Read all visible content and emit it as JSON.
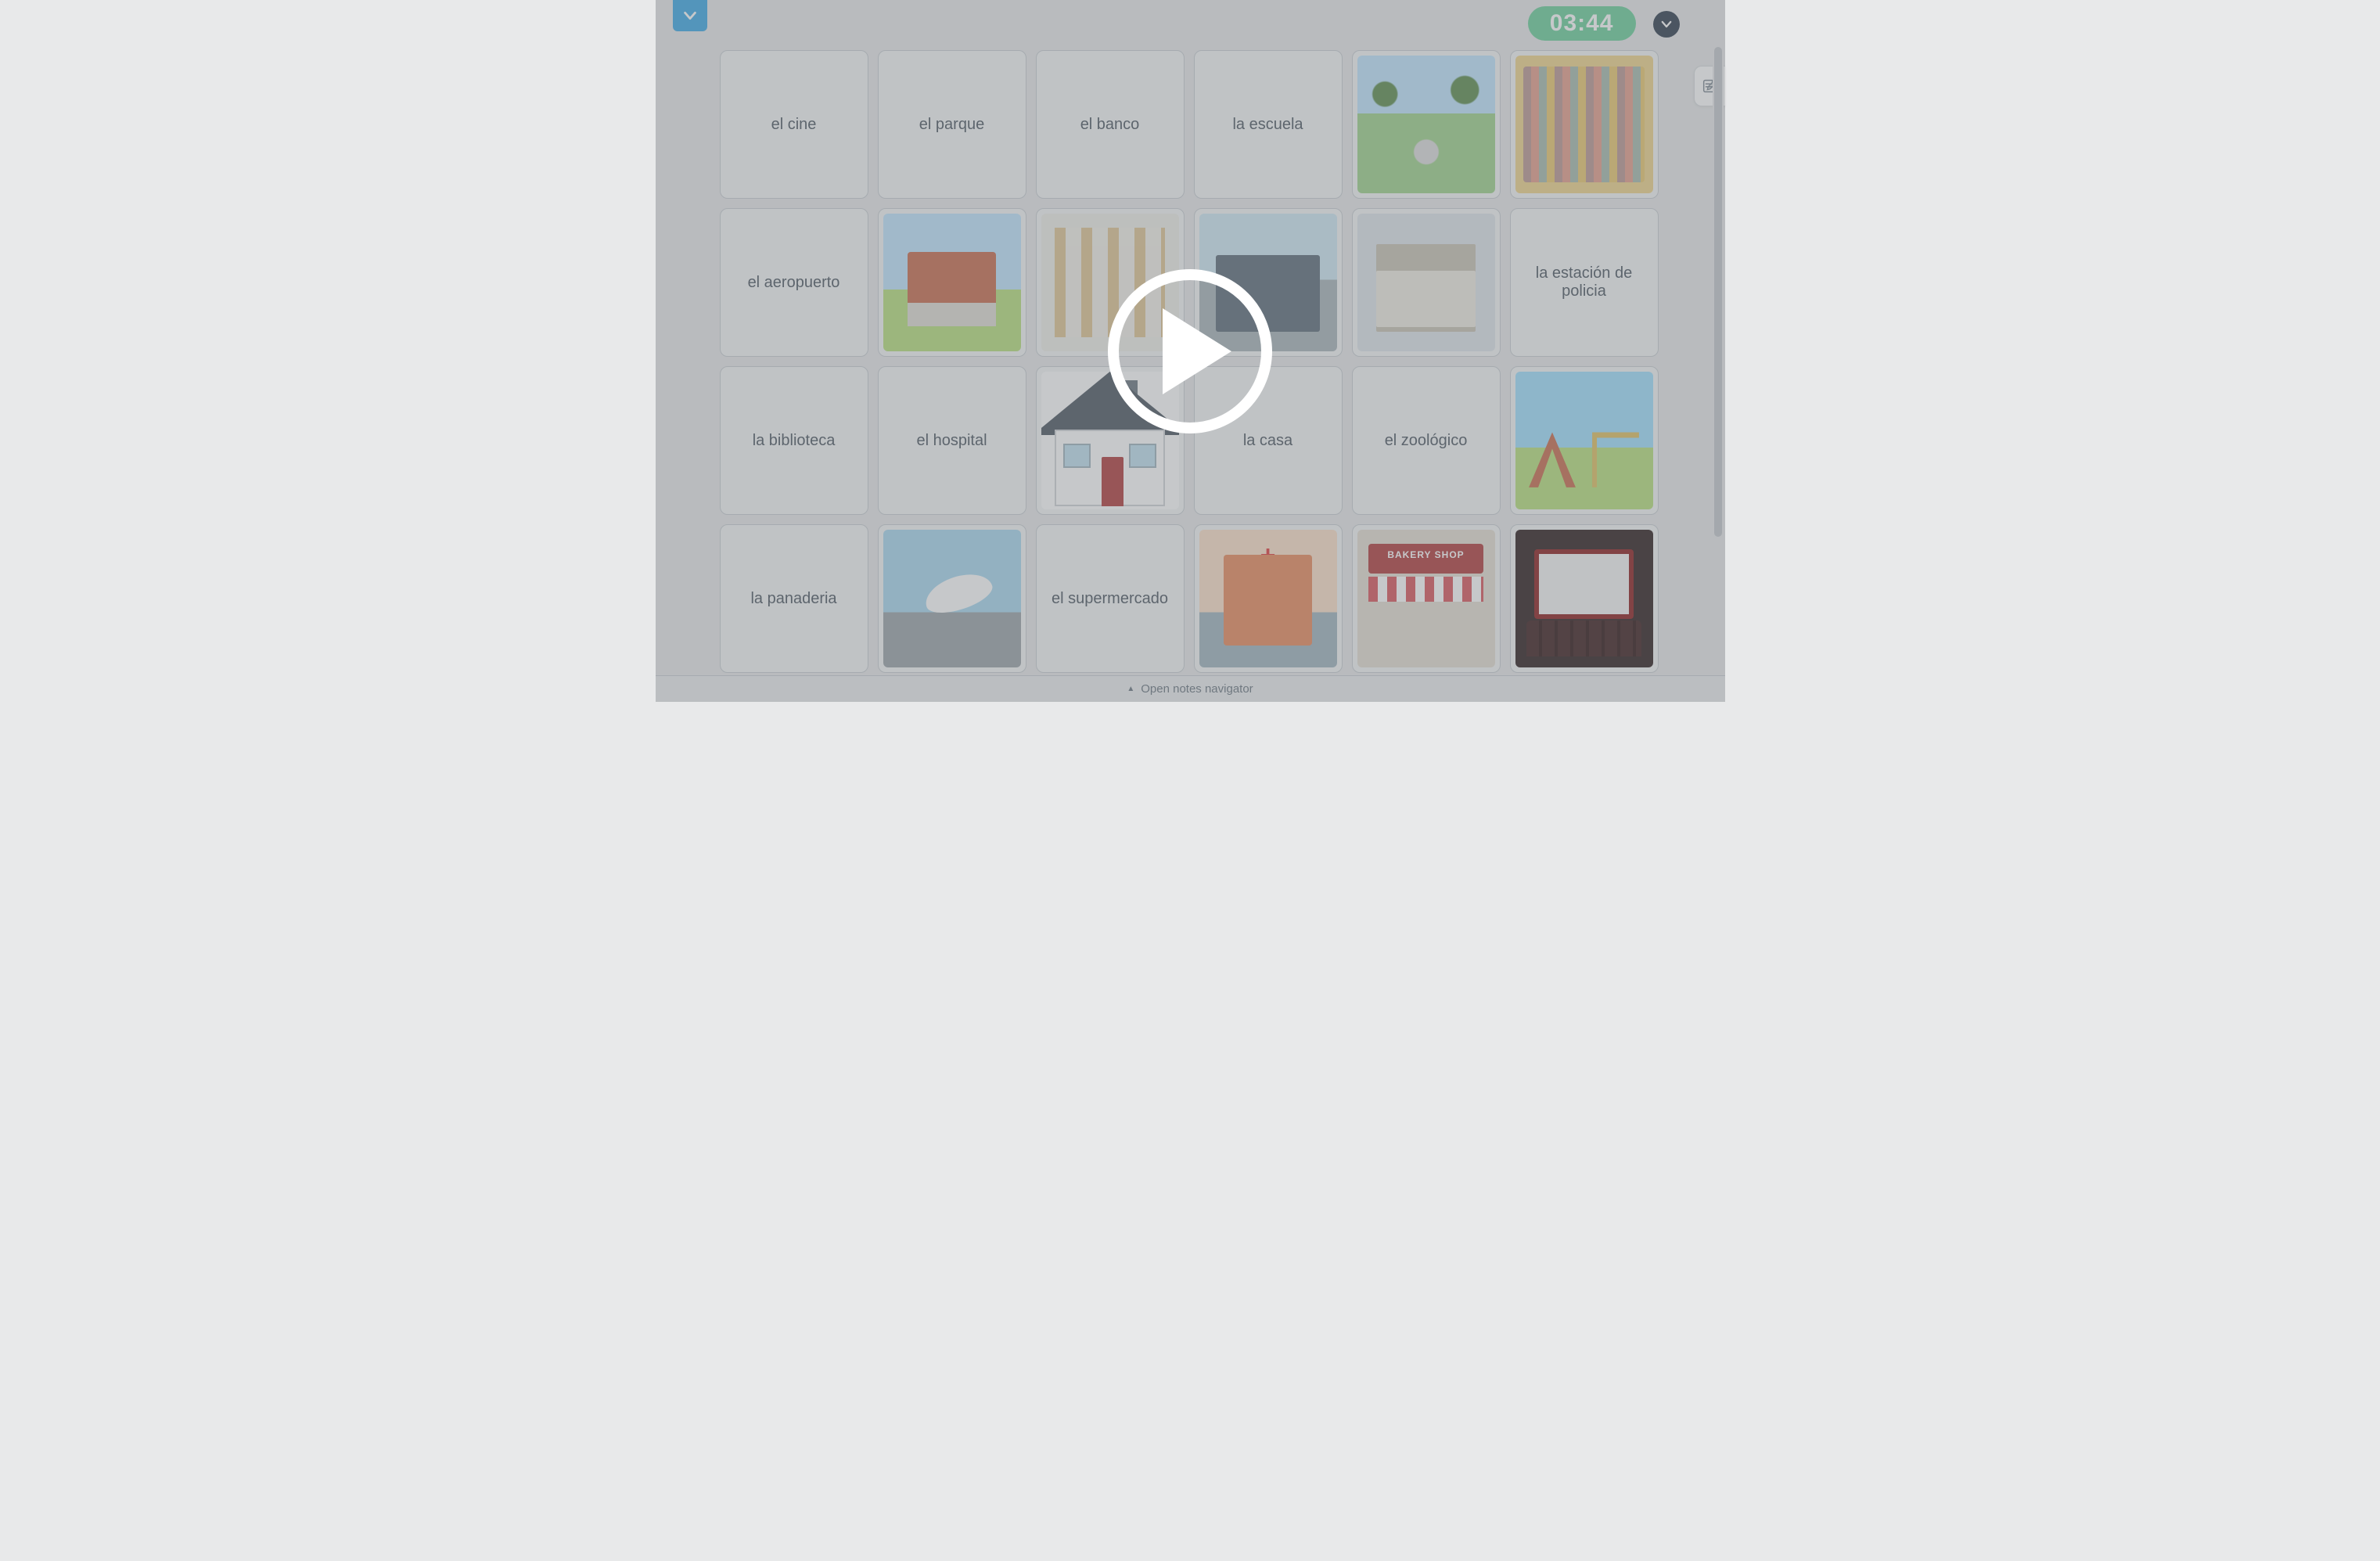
{
  "timer": "03:44",
  "footer": {
    "label": "Open notes navigator"
  },
  "bakery_sign": "BAKERY SHOP",
  "cards": [
    {
      "kind": "text",
      "label": "el cine"
    },
    {
      "kind": "text",
      "label": "el parque"
    },
    {
      "kind": "text",
      "label": "el banco"
    },
    {
      "kind": "text",
      "label": "la escuela"
    },
    {
      "kind": "image",
      "name": "zoo-image",
      "cls": "zoo"
    },
    {
      "kind": "image",
      "name": "library-image",
      "cls": "library"
    },
    {
      "kind": "text",
      "label": "el aeropuerto"
    },
    {
      "kind": "image",
      "name": "school-image",
      "cls": "schoolimg"
    },
    {
      "kind": "image",
      "name": "supermarket-image",
      "cls": "supermarketimg"
    },
    {
      "kind": "image",
      "name": "police-station-image",
      "cls": "policestation"
    },
    {
      "kind": "image",
      "name": "bank-image",
      "cls": "bankimg"
    },
    {
      "kind": "text",
      "label": "la estación de policia"
    },
    {
      "kind": "text",
      "label": "la biblioteca"
    },
    {
      "kind": "text",
      "label": "el hospital"
    },
    {
      "kind": "image",
      "name": "house-image",
      "cls": "house"
    },
    {
      "kind": "text",
      "label": "la casa"
    },
    {
      "kind": "text",
      "label": "el zoológico"
    },
    {
      "kind": "image",
      "name": "park-image",
      "cls": "parkimg"
    },
    {
      "kind": "text",
      "label": "la panaderia"
    },
    {
      "kind": "image",
      "name": "airport-image",
      "cls": "airportimg"
    },
    {
      "kind": "text",
      "label": "el supermercado"
    },
    {
      "kind": "image",
      "name": "hospital-image",
      "cls": "hospitalimg"
    },
    {
      "kind": "image",
      "name": "bakery-image",
      "cls": "bakeryimg"
    },
    {
      "kind": "image",
      "name": "cinema-image",
      "cls": "cinemaimg"
    }
  ]
}
